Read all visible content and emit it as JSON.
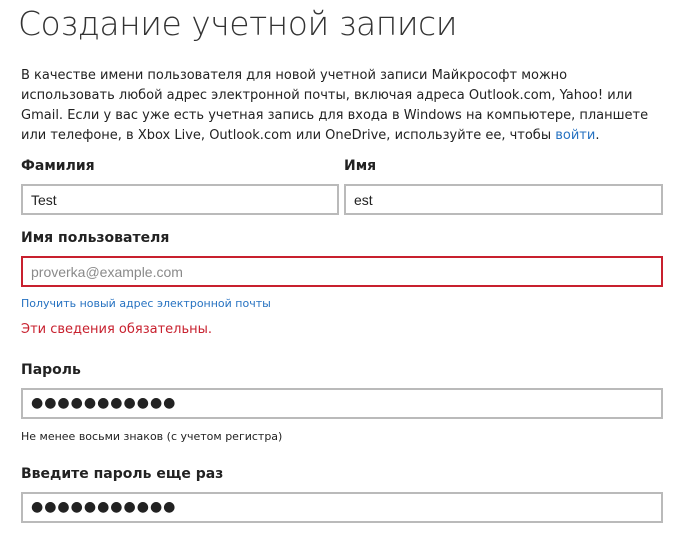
{
  "page": {
    "title": "Создание учетной записи"
  },
  "intro": {
    "text": "В качестве имени пользователя для новой учетной записи Майкрософт можно использовать любой адрес электронной почты, включая адреса Outlook.com, Yahoo! или Gmail. Если у вас уже есть учетная запись для входа в Windows на компьютере, планшете или телефоне, в Xbox Live, Outlook.com или OneDrive, используйте ее, чтобы ",
    "link": "войти",
    "suffix": "."
  },
  "form": {
    "last_name": {
      "label": "Фамилия",
      "value": "Test"
    },
    "first_name": {
      "label": "Имя",
      "value": "est"
    },
    "username": {
      "label": "Имя пользователя",
      "value": "",
      "placeholder": "proverka@example.com",
      "get_new_email_link": "Получить новый адрес электронной почты",
      "error": "Эти сведения обязательны."
    },
    "password": {
      "label": "Пароль",
      "value": "●●●●●●●●●●●",
      "hint": "Не менее восьми знаков (с учетом регистра)"
    },
    "confirm_password": {
      "label": "Введите пароль еще раз",
      "value": "●●●●●●●●●●●"
    }
  },
  "colors": {
    "link": "#2672c1",
    "error": "#c8202e",
    "border": "#bababa"
  }
}
